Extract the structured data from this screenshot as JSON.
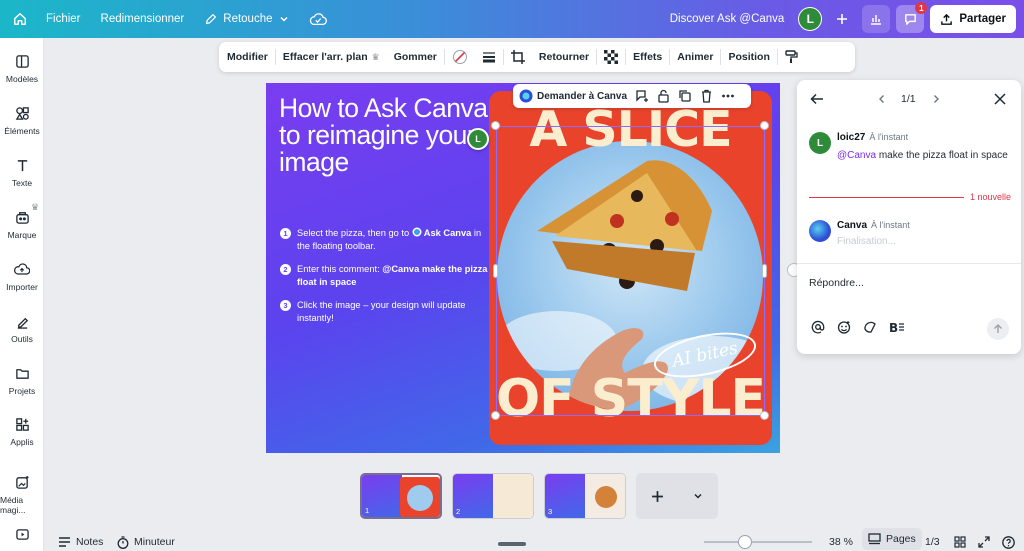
{
  "topbar": {
    "menu": [
      "Fichier",
      "Redimensionner",
      "Retouche"
    ],
    "discover": "Discover Ask @Canva",
    "avatar_letter": "L",
    "notification_count": "1",
    "share_label": "Partager"
  },
  "sidebar": {
    "items": [
      {
        "label": "Modèles",
        "icon": "templates-icon"
      },
      {
        "label": "Éléments",
        "icon": "elements-icon"
      },
      {
        "label": "Texte",
        "icon": "text-icon"
      },
      {
        "label": "Marque",
        "icon": "brand-icon"
      },
      {
        "label": "Importer",
        "icon": "upload-icon"
      },
      {
        "label": "Outils",
        "icon": "tools-icon"
      },
      {
        "label": "Projets",
        "icon": "folder-icon"
      },
      {
        "label": "Applis",
        "icon": "apps-icon"
      },
      {
        "label": "Média magi...",
        "icon": "magic-media-icon"
      }
    ]
  },
  "toolbar": {
    "items": [
      "Modifier",
      "Effacer l'arr. plan",
      "Gommer",
      "Retourner",
      "Effets",
      "Animer",
      "Position"
    ]
  },
  "float_toolbar": {
    "ask_label": "Demander à Canva"
  },
  "design": {
    "headline": "How to Ask Canva to reimagine your image",
    "steps": [
      {
        "n": "1",
        "pre": "Select the pizza, then go to ",
        "bold": "Ask Canva",
        "post": " in the floating toolbar."
      },
      {
        "n": "2",
        "pre": "Enter this comment: ",
        "bold": "@Canva make the pizza float in space",
        "post": ""
      },
      {
        "n": "3",
        "pre": "Click the image – your design will update instantly!",
        "bold": "",
        "post": ""
      }
    ],
    "art_top": "A SLICE",
    "art_bottom": "OF STYLE",
    "art_badge": "AI bites"
  },
  "comment_pin_letter": "L",
  "comments_panel": {
    "pager": "1/1",
    "comments": [
      {
        "author": "loic27",
        "time": "À l'instant",
        "mention": "@Canva",
        "text": " make the pizza float in space",
        "avatar_letter": "L"
      },
      {
        "author": "Canva",
        "time": "À l'instant",
        "text": "Finalisation..."
      }
    ],
    "new_label": "1 nouvelle",
    "reply_placeholder": "Répondre..."
  },
  "pages": {
    "thumbs": [
      "1",
      "2",
      "3"
    ]
  },
  "bottom": {
    "notes": "Notes",
    "timer": "Minuteur",
    "zoom": "38 %",
    "pages_label": "Pages",
    "page_count": "1/3"
  },
  "colors": {
    "accent": "#7d2ae8",
    "art_red": "#e9442b",
    "avatar_green": "#2e8b3a",
    "new_red": "#e0364a"
  }
}
